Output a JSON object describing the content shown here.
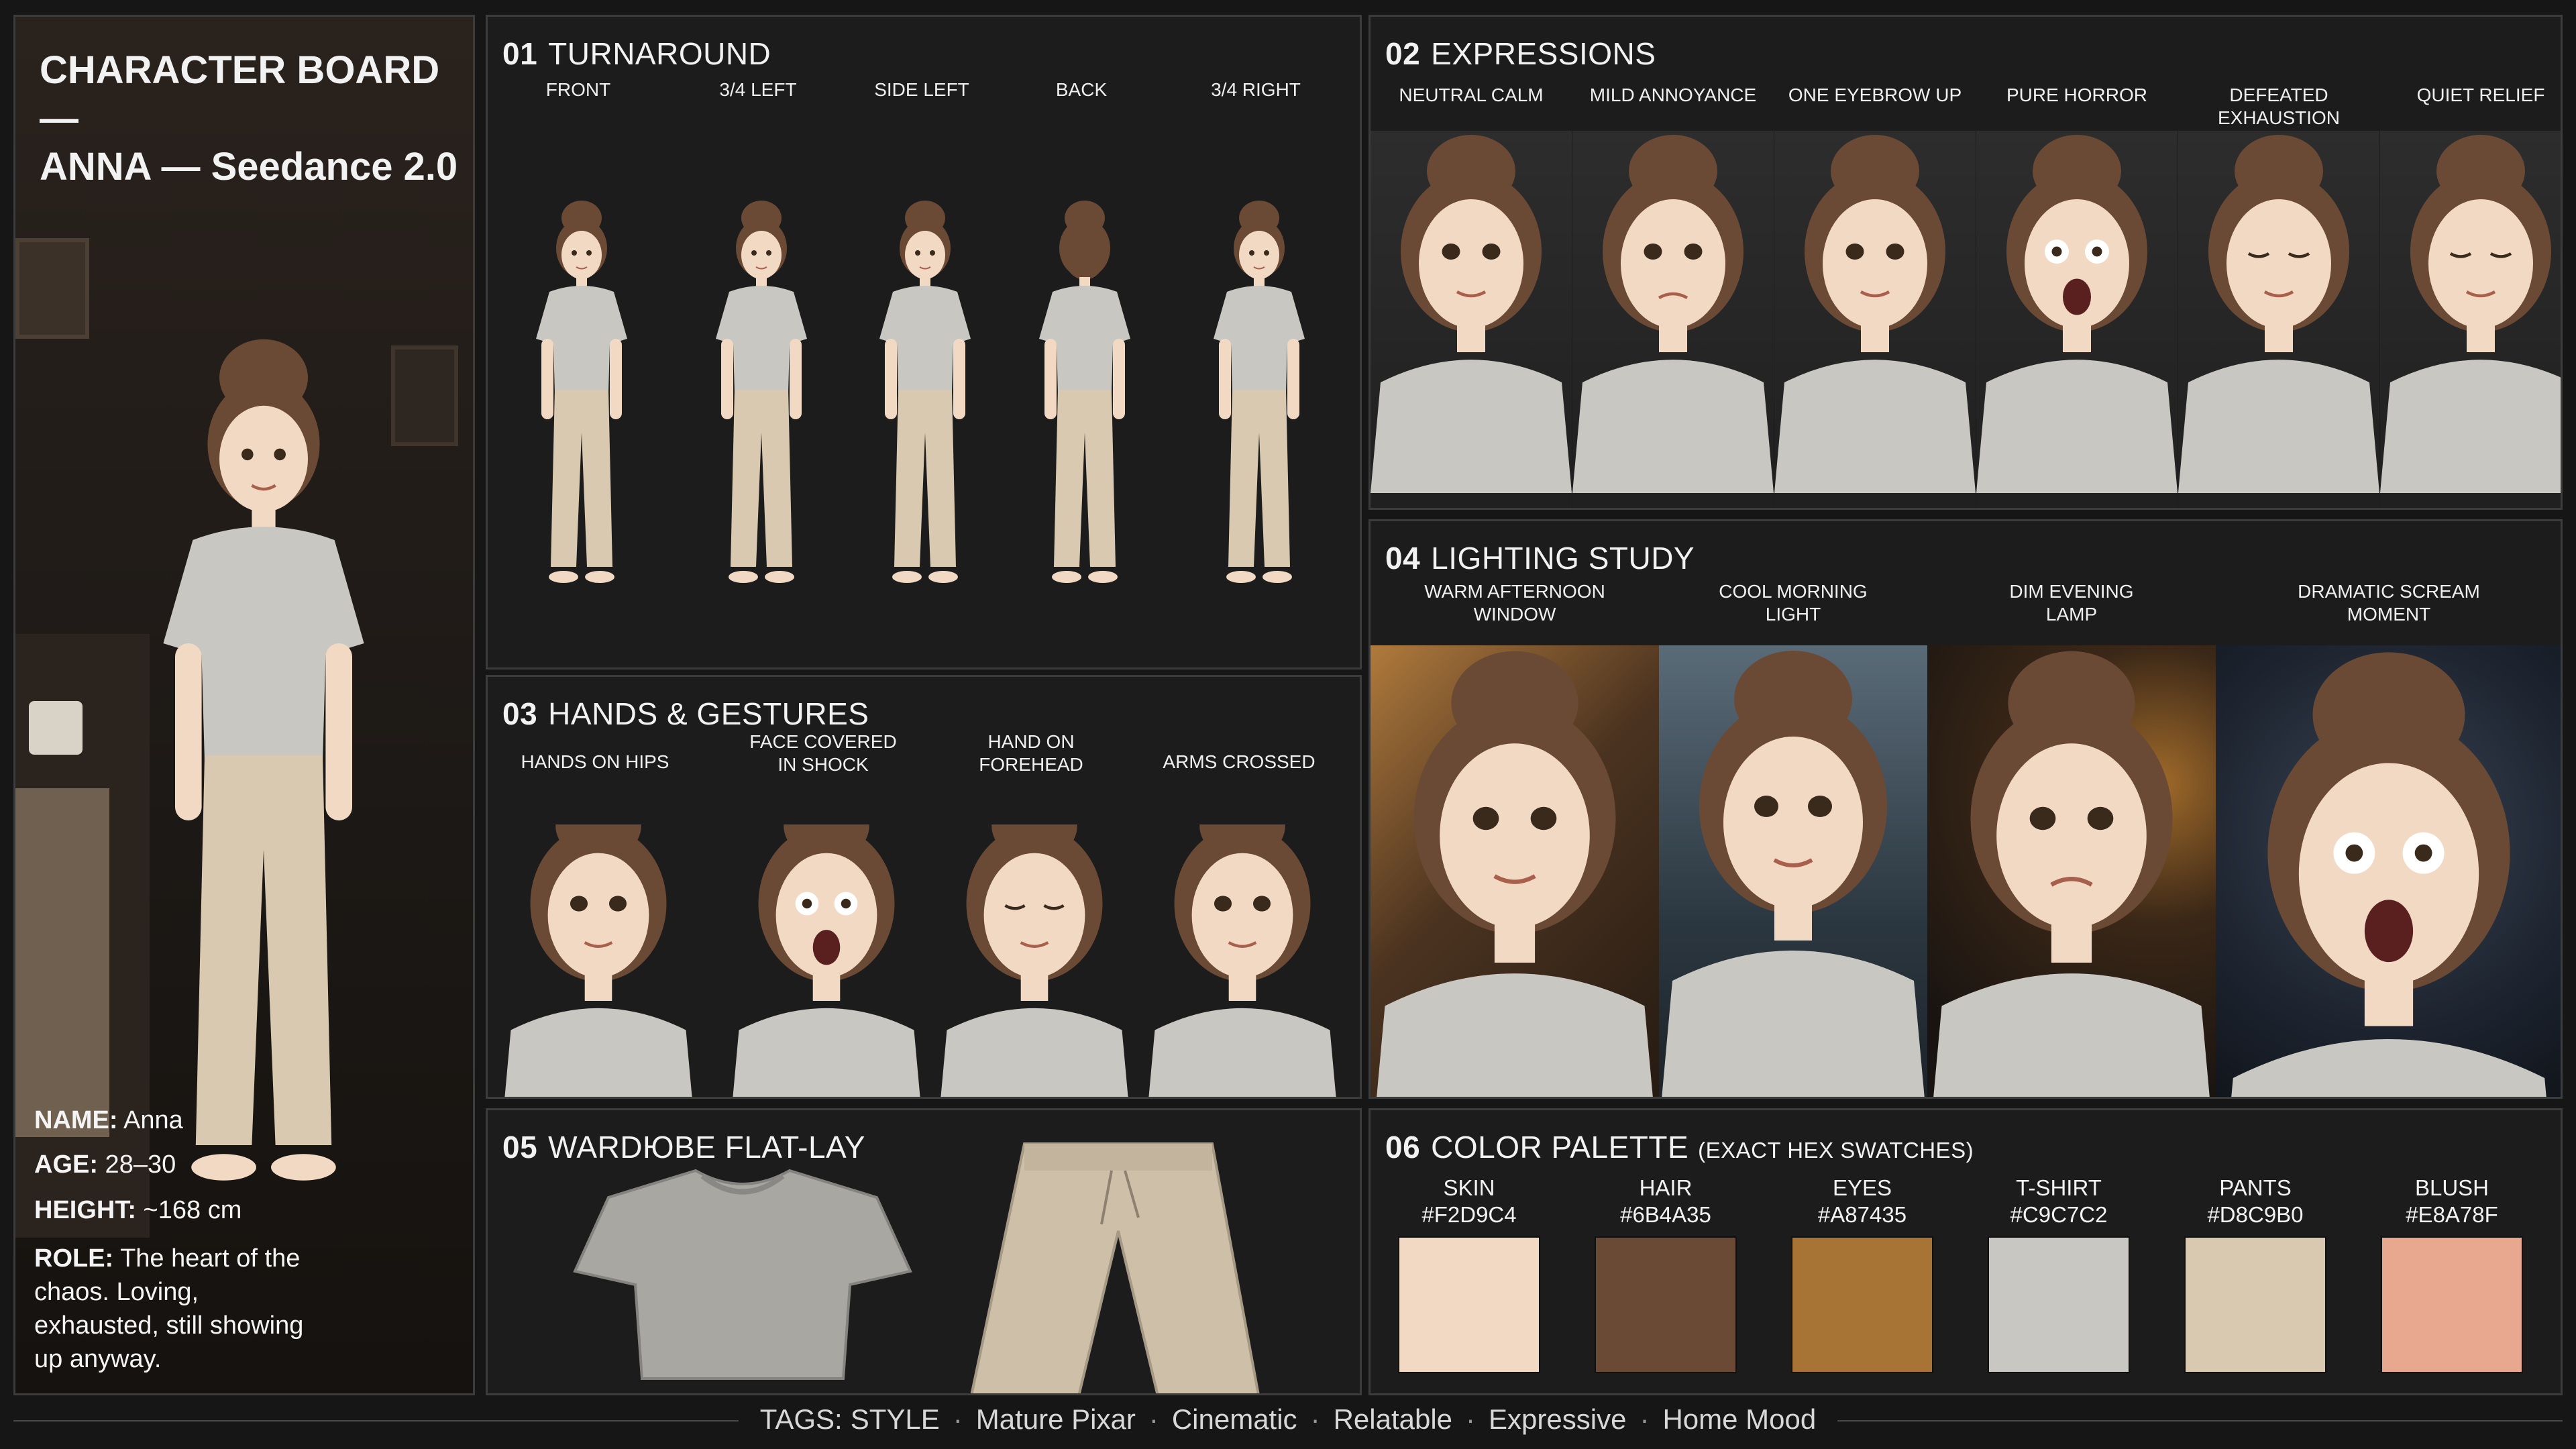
{
  "hero": {
    "title": "CHARACTER BOARD —\nANNA — Seedance 2.0",
    "bio": [
      {
        "key": "NAME:",
        "value": " Anna"
      },
      {
        "key": "AGE:",
        "value": " 28–30"
      },
      {
        "key": "HEIGHT:",
        "value": " ~168 cm"
      },
      {
        "key": "ROLE:",
        "value": " The heart of the chaos. Loving, exhausted, still showing up anyway."
      }
    ]
  },
  "panels": {
    "turnaround": {
      "num": "01",
      "title": "TURNAROUND",
      "views": [
        "FRONT",
        "3/4 LEFT",
        "SIDE LEFT",
        "BACK",
        "3/4 RIGHT"
      ]
    },
    "expressions": {
      "num": "02",
      "title": "EXPRESSIONS",
      "items": [
        "NEUTRAL CALM",
        "MILD ANNOYANCE",
        "ONE EYEBROW UP",
        "PURE HORROR",
        "DEFEATED EXHAUSTION",
        "QUIET RELIEF"
      ]
    },
    "hands": {
      "num": "03",
      "title": "HANDS & GESTURES",
      "items": [
        "HANDS ON HIPS",
        "FACE COVERED\nIN SHOCK",
        "HAND ON\nFOREHEAD",
        "ARMS CROSSED"
      ]
    },
    "lighting": {
      "num": "04",
      "title": "LIGHTING STUDY",
      "items": [
        "WARM AFTERNOON\nWINDOW",
        "COOL MORNING\nLIGHT",
        "DIM EVENING\nLAMP",
        "DRAMATIC SCREAM\nMOMENT"
      ]
    },
    "wardrobe": {
      "num": "05",
      "title": "WARDЮBE FLAT-LAY"
    },
    "palette": {
      "num": "06",
      "title": "COLOR PALETTE",
      "subtitle": "(EXACT HEX SWATCHES)",
      "swatches": [
        {
          "name": "SKIN",
          "hex": "#F2D9C4"
        },
        {
          "name": "HAIR",
          "hex": "#6B4A35"
        },
        {
          "name": "EYES",
          "hex": "#A87435"
        },
        {
          "name": "T-SHIRT",
          "hex": "#C9C7C2"
        },
        {
          "name": "PANTS",
          "hex": "#D8C9B0"
        },
        {
          "name": "BLUSH",
          "hex": "#E8A78F"
        }
      ]
    }
  },
  "tags": {
    "label": "TAGS:",
    "items": [
      "STYLE",
      "Mature Pixar",
      "Cinematic",
      "Relatable",
      "Expressive",
      "Home Mood"
    ]
  },
  "colors": {
    "skin": "#F2D9C4",
    "hair": "#6B4A35",
    "shirt": "#C9C7C2",
    "pants": "#D8C9B0"
  }
}
